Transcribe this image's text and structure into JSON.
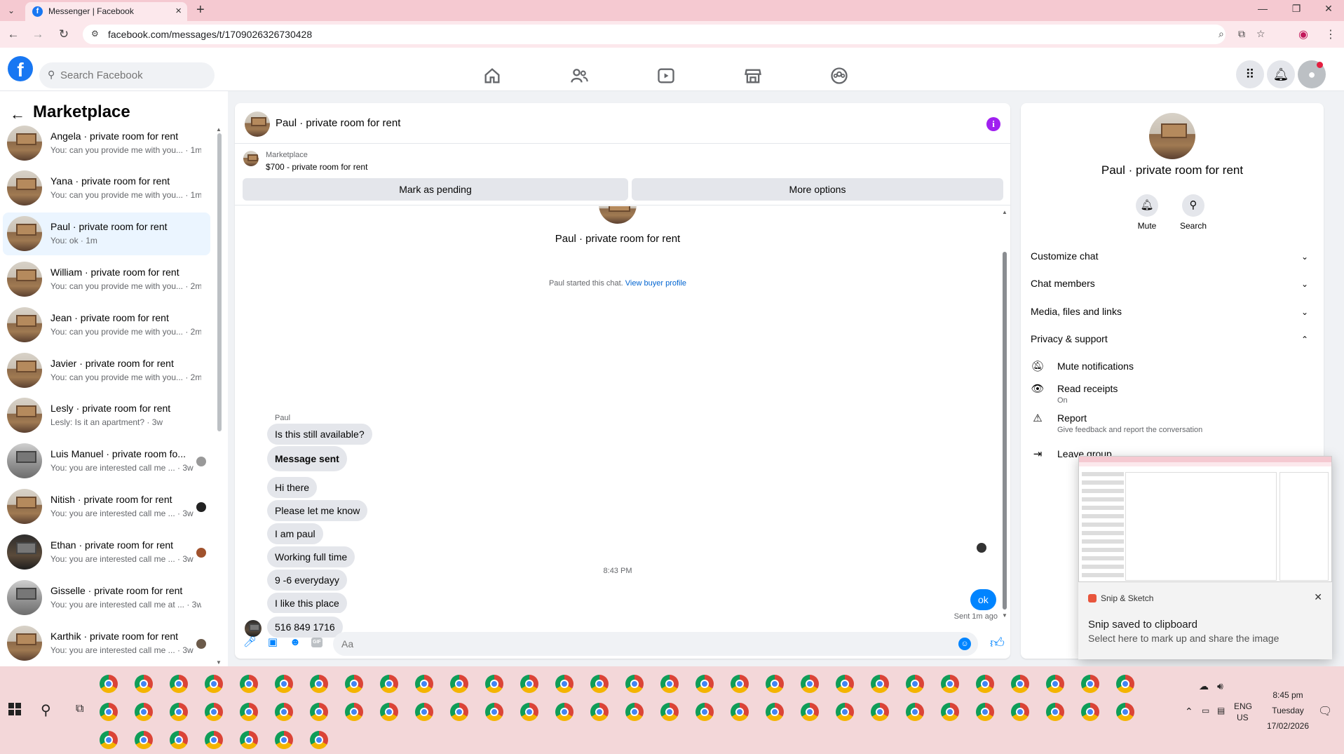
{
  "browser": {
    "tab_title": "Messenger | Facebook",
    "url": "facebook.com/messages/t/1709026326730428",
    "new_tab": "+",
    "tab_close": "×"
  },
  "header": {
    "search_placeholder": "Search Facebook",
    "logo": "f"
  },
  "sidebar": {
    "title": "Marketplace",
    "conversations": [
      {
        "name": "Angela · private room for rent",
        "preview": "You: can you provide me with you... · 1m"
      },
      {
        "name": "Yana · private room for rent",
        "preview": "You: can you provide me with you... · 1m"
      },
      {
        "name": "Paul · private room for rent",
        "preview": "You: ok · 1m"
      },
      {
        "name": "William · private room for rent",
        "preview": "You: can you provide me with you... · 2m"
      },
      {
        "name": "Jean · private room for rent",
        "preview": "You: can you provide me with you... · 2m"
      },
      {
        "name": "Javier · private room for rent",
        "preview": "You: can you provide me with you... · 2m"
      },
      {
        "name": "Lesly · private room for rent",
        "preview": "Lesly: Is it an apartment? · 3w"
      },
      {
        "name": "Luis Manuel · private room fo...",
        "preview": "You: you are interested call me ... · 3w"
      },
      {
        "name": "Nitish · private room for rent",
        "preview": "You: you are interested call me ... · 3w"
      },
      {
        "name": "Ethan · private room for rent",
        "preview": "You: you are interested call me ... · 3w"
      },
      {
        "name": "Gisselle · private room for rent",
        "preview": "You: you are interested call me at ... · 3w"
      },
      {
        "name": "Karthik · private room for rent",
        "preview": "You: you are interested call me ... · 3w"
      }
    ]
  },
  "chat": {
    "title": "Paul · private room for rent",
    "info_icon": "i",
    "marketplace_label": "Marketplace",
    "listing": "$700 - private room for rent",
    "mark_pending": "Mark as pending",
    "more_options": "More options",
    "profile_name": "Paul · private room for rent",
    "started_text": "Paul started this chat.",
    "view_profile": "View buyer profile",
    "sender_label": "Paul",
    "messages": [
      "Is this still available?",
      "Message sent",
      "Hi there",
      "Please let me know",
      "I am paul",
      "Working full time",
      "9 -6 everydayy",
      "I like this place",
      "516 849 1716"
    ],
    "time_separator": "8:43 PM",
    "outgoing_message": "ok",
    "sent_status": "Sent 1m ago",
    "composer_placeholder": "Aa",
    "gif_label": "GIF"
  },
  "details": {
    "name": "Paul · private room for rent",
    "mute_label": "Mute",
    "search_label": "Search",
    "sections": [
      "Customize chat",
      "Chat members",
      "Media, files and links",
      "Privacy & support"
    ],
    "privacy_items": [
      {
        "title": "Mute notifications",
        "subtitle": ""
      },
      {
        "title": "Read receipts",
        "subtitle": "On"
      },
      {
        "title": "Report",
        "subtitle": "Give feedback and report the conversation"
      },
      {
        "title": "Leave group",
        "subtitle": ""
      }
    ]
  },
  "notification": {
    "app": "Snip & Sketch",
    "title": "Snip saved to clipboard",
    "body": "Select here to mark up and share the image",
    "close": "✕"
  },
  "tray": {
    "lang": "ENG",
    "region": "US",
    "time": "8:45 pm",
    "day": "Tuesday",
    "date": "17/02/2026"
  }
}
